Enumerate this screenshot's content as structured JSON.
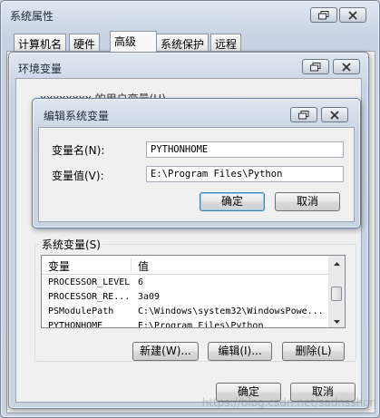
{
  "sysprops": {
    "title": "系统属性",
    "tabs": [
      {
        "label": "计算机名"
      },
      {
        "label": "硬件"
      },
      {
        "label": "高级"
      },
      {
        "label": "系统保护"
      },
      {
        "label": "远程"
      }
    ]
  },
  "envvars": {
    "title": "环境变量",
    "hidden_user_vars_label": "xxxxxxxx 的用户变量(U)",
    "system_vars_label": "系统变量(S)",
    "columns": {
      "name": "变量",
      "value": "值"
    },
    "rows": [
      {
        "name": "PROCESSOR_LEVEL",
        "value": "6"
      },
      {
        "name": "PROCESSOR_RE...",
        "value": "3a09"
      },
      {
        "name": "PSModulePath",
        "value": "C:\\Windows\\system32\\WindowsPowe..."
      },
      {
        "name": "PYTHONHOME",
        "value": "E:\\Program Files\\Python"
      }
    ],
    "new_button": "新建(W)...",
    "edit_button": "编辑(I)...",
    "delete_button": "删除(L)",
    "ok_button": "确定",
    "cancel_button": "取消"
  },
  "editdialog": {
    "title": "编辑系统变量",
    "name_label": "变量名(N):",
    "name_value": "PYTHONHOME",
    "value_label": "变量值(V):",
    "value_value": "E:\\Program Files\\Python",
    "ok_button": "确定",
    "cancel_button": "取消"
  },
  "watermark": "https://blog.csdn.net/sadnsshon",
  "icons": {
    "restore": "restore-window-icon",
    "close": "close-icon",
    "scroll_up": "scroll-up-arrow-icon",
    "scroll_down": "scroll-down-arrow-icon"
  }
}
